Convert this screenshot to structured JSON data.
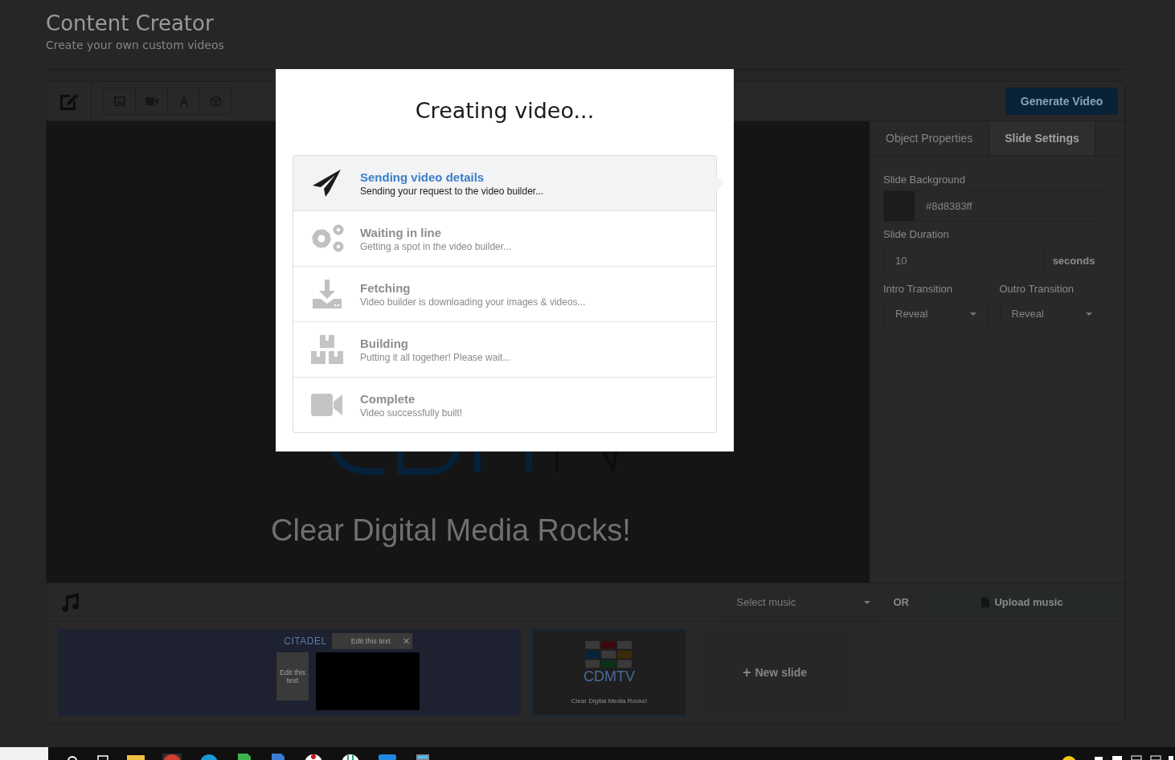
{
  "header": {
    "title": "Content Creator",
    "subtitle": "Create your own custom videos"
  },
  "toolbar": {
    "generate_button": "Generate Video"
  },
  "canvas": {
    "caption": "Clear Digital Media Rocks!"
  },
  "settings": {
    "tabs": [
      {
        "label": "Object Properties",
        "selected": false
      },
      {
        "label": "Slide Settings",
        "selected": true
      }
    ],
    "background_label": "Slide Background",
    "background_value": "#8d8383ff",
    "duration_label": "Slide Duration",
    "duration_value": "10",
    "duration_unit": "seconds",
    "intro_label": "Intro Transition",
    "intro_value": "Reveal",
    "outro_label": "Outro Transition",
    "outro_value": "Reveal"
  },
  "music": {
    "placeholder": "Select music",
    "or": "OR",
    "upload_button": "Upload music"
  },
  "slides": [
    {
      "kind": "citadel",
      "logo": "CITADEL",
      "texts": [
        "Edit this text",
        "Edit this text"
      ],
      "close": "✕",
      "selected": false
    },
    {
      "kind": "cdmtv",
      "logo": "CDMTV",
      "caption": "Clear Digital Media Rocks!",
      "selected": true
    }
  ],
  "new_slide": "New slide",
  "new_slide_plus": "+",
  "modal": {
    "title": "Creating video...",
    "steps": [
      {
        "title": "Sending video details",
        "description": "Sending your request to the video builder...",
        "selected": true
      },
      {
        "title": "Waiting in line",
        "description": "Getting a spot in the video builder...",
        "selected": false
      },
      {
        "title": "Fetching",
        "description": "Video builder is downloading your images & videos...",
        "selected": false
      },
      {
        "title": "Building",
        "description": "Putting it all together! Please wait...",
        "selected": false
      },
      {
        "title": "Complete",
        "description": "Video successfully built!",
        "selected": false
      }
    ]
  }
}
